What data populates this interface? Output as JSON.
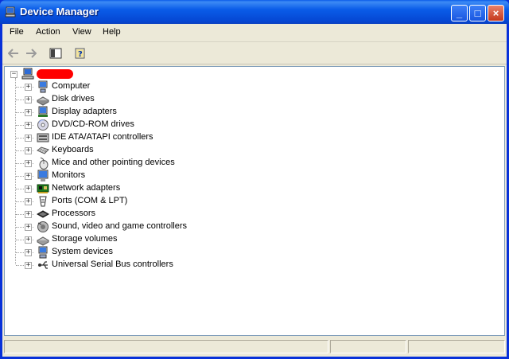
{
  "window": {
    "title": "Device Manager"
  },
  "title_buttons": {
    "minimize": "_",
    "maximize": "□",
    "close": "×"
  },
  "menu": [
    "File",
    "Action",
    "View",
    "Help"
  ],
  "toolbar": {
    "icons": [
      "back-arrow-icon",
      "forward-arrow-icon",
      "show-hide-console-tree-icon",
      "help-icon"
    ]
  },
  "tree": {
    "root_label": "",
    "root_expander": "−",
    "expander": "+",
    "categories": [
      {
        "label": "Computer",
        "icon": "computer-icon"
      },
      {
        "label": "Disk drives",
        "icon": "disk-drive-icon"
      },
      {
        "label": "Display adapters",
        "icon": "display-adapter-icon"
      },
      {
        "label": "DVD/CD-ROM drives",
        "icon": "cdrom-icon"
      },
      {
        "label": "IDE ATA/ATAPI controllers",
        "icon": "ide-controller-icon"
      },
      {
        "label": "Keyboards",
        "icon": "keyboard-icon"
      },
      {
        "label": "Mice and other pointing devices",
        "icon": "mouse-icon"
      },
      {
        "label": "Monitors",
        "icon": "monitor-icon"
      },
      {
        "label": "Network adapters",
        "icon": "network-adapter-icon"
      },
      {
        "label": "Ports (COM & LPT)",
        "icon": "port-icon"
      },
      {
        "label": "Processors",
        "icon": "processor-icon"
      },
      {
        "label": "Sound, video and game controllers",
        "icon": "sound-icon"
      },
      {
        "label": "Storage volumes",
        "icon": "storage-icon"
      },
      {
        "label": "System devices",
        "icon": "system-device-icon"
      },
      {
        "label": "Universal Serial Bus controllers",
        "icon": "usb-icon"
      }
    ]
  },
  "statusbar": {
    "panes": [
      "",
      "",
      ""
    ]
  }
}
